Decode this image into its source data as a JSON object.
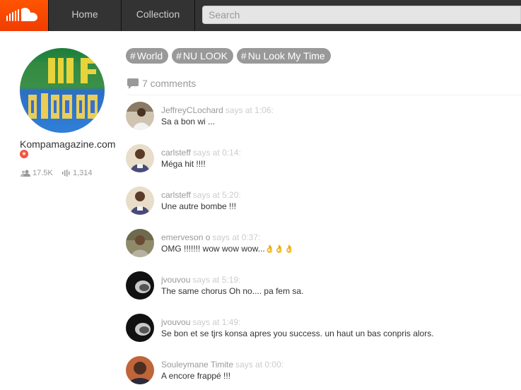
{
  "header": {
    "logo_icon": "soundcloud-cloud-icon",
    "nav": {
      "home": "Home",
      "collection": "Collection"
    },
    "search_placeholder": "Search",
    "brand_color": "#ff5500"
  },
  "artist": {
    "name": "Kompamagazine.com",
    "pro_badge_icon": "pro-star-icon",
    "followers": "17.5K",
    "tracks": "1,314"
  },
  "tags": [
    {
      "hash": "#",
      "label": "World"
    },
    {
      "hash": "#",
      "label": "NU LOOK"
    },
    {
      "hash": "#",
      "label": "Nu Look My Time"
    }
  ],
  "comments_header": {
    "icon": "speech-bubble-icon",
    "count_label": "7 comments"
  },
  "comments": [
    {
      "user": "JeffreyCLochard",
      "says": "says at 1:06:",
      "text": "Sa a bon wi ..."
    },
    {
      "user": "carlsteff",
      "says": "says at 0:14:",
      "text": "Méga hit !!!!"
    },
    {
      "user": "carlsteff",
      "says": "says at 5:20:",
      "text": "Une autre bombe !!!"
    },
    {
      "user": "emerveson o",
      "says": "says at 0:37:",
      "text": "OMG !!!!!!! wow wow wow...",
      "emoji": "👌👌👌"
    },
    {
      "user": "jvouvou",
      "says": "says at 5:19:",
      "text": "The same chorus Oh no.... pa fem sa."
    },
    {
      "user": "jvouvou",
      "says": "says at 1:49:",
      "text": "Se bon et se tjrs konsa apres you success. un haut un bas conpris alors."
    },
    {
      "user": "Souleymane Timite",
      "says": "says at 0:00:",
      "text": "A encore frappé !!!"
    }
  ]
}
